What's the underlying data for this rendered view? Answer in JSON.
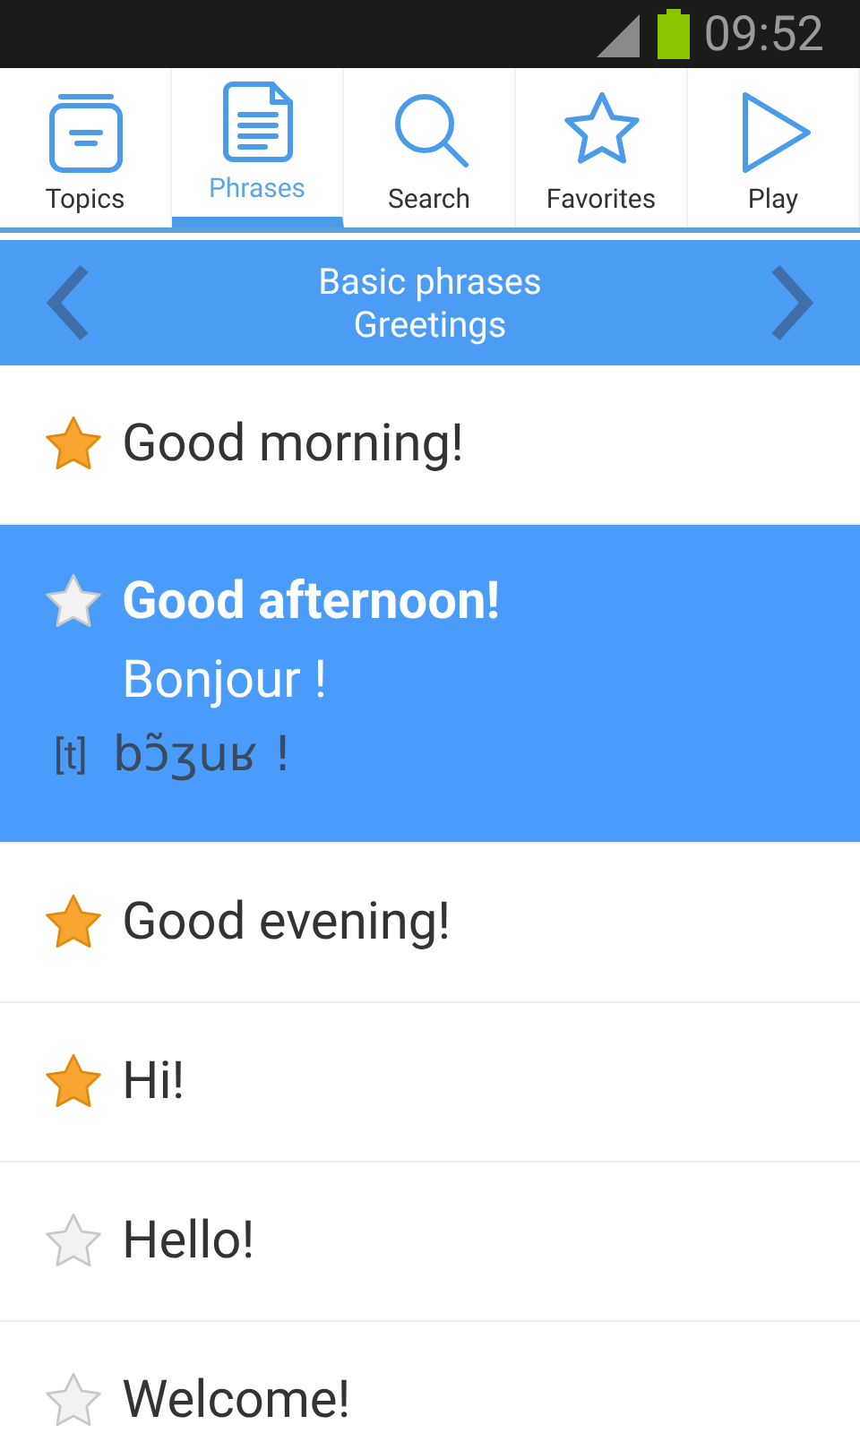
{
  "status_bar": {
    "time": "09:52"
  },
  "tabs": [
    {
      "label": "Topics",
      "kind": "topics",
      "selected": false
    },
    {
      "label": "Phrases",
      "kind": "phrases",
      "selected": true
    },
    {
      "label": "Search",
      "kind": "search",
      "selected": false
    },
    {
      "label": "Favorites",
      "kind": "favorites",
      "selected": false
    },
    {
      "label": "Play",
      "kind": "play",
      "selected": false
    }
  ],
  "header": {
    "title": "Basic phrases",
    "subtitle": "Greetings"
  },
  "phrases": [
    {
      "text": "Good morning!",
      "favorite": true,
      "selected": false
    },
    {
      "text": "Good afternoon!",
      "favorite": false,
      "selected": true,
      "translation": "Bonjour !",
      "transcription_label": "[t]",
      "transcription": "bɔ̃ʒuʁ !"
    },
    {
      "text": "Good evening!",
      "favorite": true,
      "selected": false
    },
    {
      "text": "Hi!",
      "favorite": true,
      "selected": false
    },
    {
      "text": "Hello!",
      "favorite": false,
      "selected": false
    },
    {
      "text": "Welcome!",
      "favorite": false,
      "selected": false
    }
  ]
}
